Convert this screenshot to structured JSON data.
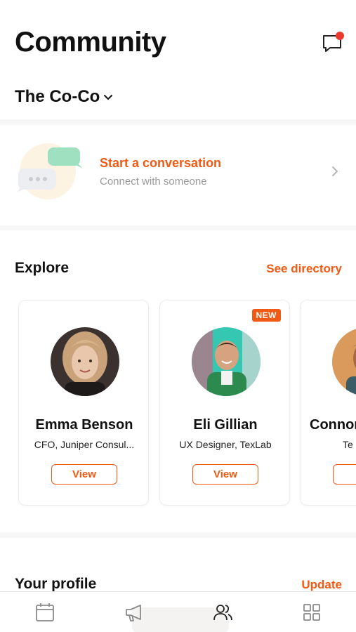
{
  "header": {
    "title": "Community",
    "community_name": "The Co-Co",
    "chat_icon": "chat-bubble-icon",
    "notification_color": "#e83a2e"
  },
  "conversation": {
    "title": "Start a conversation",
    "subtitle": "Connect with someone"
  },
  "explore": {
    "title": "Explore",
    "see_directory": "See directory",
    "people": [
      {
        "name": "Emma Benson",
        "role": "CFO, Juniper Consul...",
        "view_label": "View",
        "badge": ""
      },
      {
        "name": "Eli Gillian",
        "role": "UX Designer, TexLab",
        "view_label": "View",
        "badge": "NEW"
      },
      {
        "name": "Connor",
        "role": "Te",
        "view_label": "V",
        "badge": ""
      }
    ]
  },
  "profile": {
    "title": "Your profile",
    "update_label": "Update"
  },
  "tabbar": {
    "tabs": [
      {
        "icon": "calendar-icon"
      },
      {
        "icon": "megaphone-icon"
      },
      {
        "icon": "people-icon",
        "active": true
      },
      {
        "icon": "grid-icon"
      }
    ]
  },
  "colors": {
    "accent": "#f05a14",
    "muted_text": "#9a9a9a",
    "background": "#f7f7f7"
  }
}
